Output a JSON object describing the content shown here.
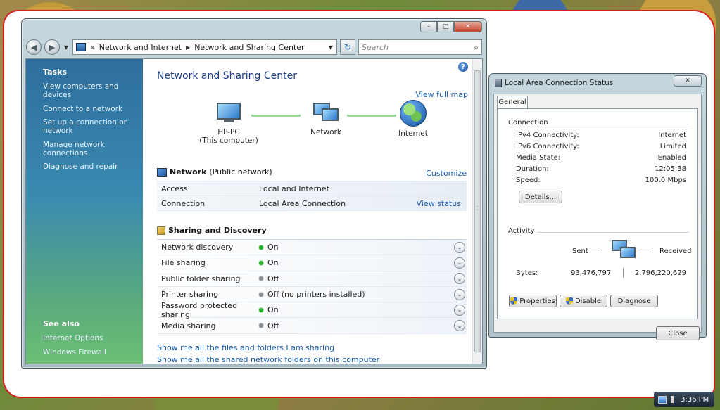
{
  "window": {
    "address": {
      "crumb1": "Network and Internet",
      "crumb2": "Network and Sharing Center"
    },
    "search_placeholder": "Search"
  },
  "sidebar": {
    "tasks_title": "Tasks",
    "tasks": [
      "View computers and devices",
      "Connect to a network",
      "Set up a connection or network",
      "Manage network connections",
      "Diagnose and repair"
    ],
    "see_also_title": "See also",
    "see_also": [
      "Internet Options",
      "Windows Firewall"
    ]
  },
  "main": {
    "title": "Network and Sharing Center",
    "view_full_map": "View full map",
    "map": {
      "computer_name": "HP-PC",
      "computer_sub": "(This computer)",
      "network": "Network",
      "internet": "Internet"
    },
    "network_section": {
      "name": "Network",
      "type": "(Public network)",
      "customize": "Customize",
      "rows": [
        {
          "key": "Access",
          "value": "Local and Internet",
          "action": ""
        },
        {
          "key": "Connection",
          "value": "Local Area Connection",
          "action": "View status"
        }
      ]
    },
    "sharing_section": {
      "title": "Sharing and Discovery",
      "rows": [
        {
          "key": "Network discovery",
          "status": "On",
          "on": true
        },
        {
          "key": "File sharing",
          "status": "On",
          "on": true
        },
        {
          "key": "Public folder sharing",
          "status": "Off",
          "on": false
        },
        {
          "key": "Printer sharing",
          "status": "Off (no printers installed)",
          "on": false
        },
        {
          "key": "Password protected sharing",
          "status": "On",
          "on": true
        },
        {
          "key": "Media sharing",
          "status": "Off",
          "on": false
        }
      ]
    },
    "bottom_links": [
      "Show me all the files and folders I am sharing",
      "Show me all the shared network folders on this computer"
    ]
  },
  "status_dialog": {
    "title": "Local Area Connection Status",
    "tab": "General",
    "connection_title": "Connection",
    "connection": [
      {
        "key": "IPv4 Connectivity:",
        "value": "Internet"
      },
      {
        "key": "IPv6 Connectivity:",
        "value": "Limited"
      },
      {
        "key": "Media State:",
        "value": "Enabled"
      },
      {
        "key": "Duration:",
        "value": "12:05:38"
      },
      {
        "key": "Speed:",
        "value": "100.0 Mbps"
      }
    ],
    "details_button": "Details...",
    "activity_title": "Activity",
    "sent_label": "Sent",
    "received_label": "Received",
    "bytes_label": "Bytes:",
    "bytes_sent": "93,476,797",
    "bytes_received": "2,796,220,629",
    "properties_button": "Properties",
    "disable_button": "Disable",
    "diagnose_button": "Diagnose",
    "close_button": "Close"
  },
  "tray": {
    "time": "3:36 PM"
  },
  "colors": {
    "link": "#1a5fb4",
    "title": "#1e3d83",
    "status_on": "#27b02a",
    "status_off": "#8b8f92"
  }
}
